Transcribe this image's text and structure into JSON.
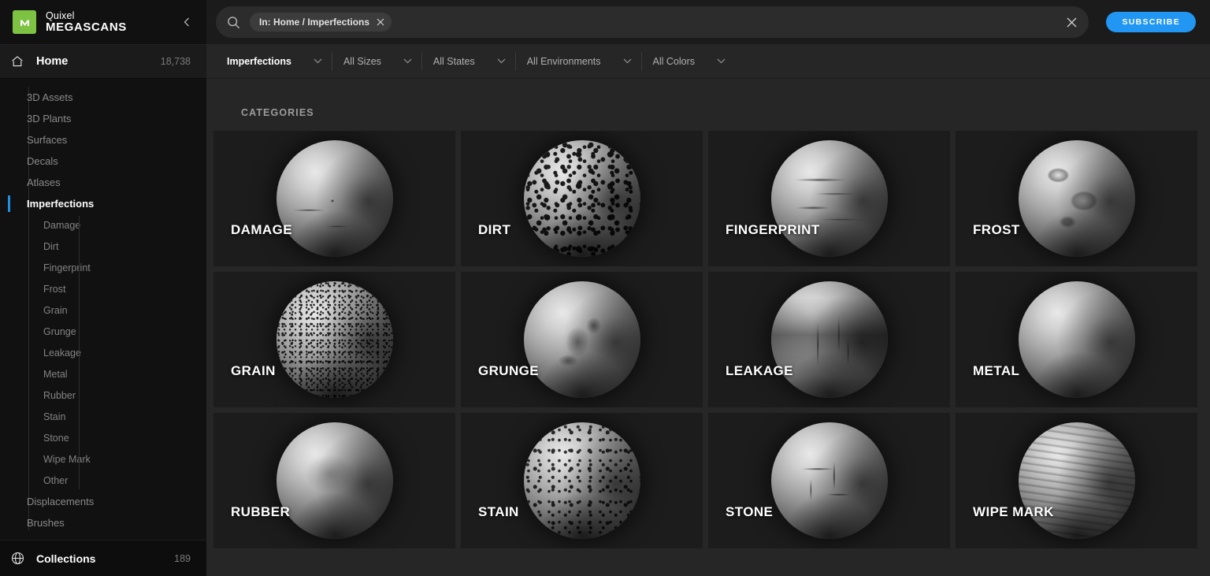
{
  "sidebar": {
    "brand": {
      "top": "Quixel",
      "bottom": "MEGASCANS",
      "collapse_icon": "chevron-left-icon",
      "logo_letter": "m",
      "logo_color": "#7dc242"
    },
    "home": {
      "label": "Home",
      "count": "18,738",
      "icon": "home-icon"
    },
    "items": [
      {
        "label": "3D Assets",
        "active": false
      },
      {
        "label": "3D Plants",
        "active": false
      },
      {
        "label": "Surfaces",
        "active": false
      },
      {
        "label": "Decals",
        "active": false
      },
      {
        "label": "Atlases",
        "active": false
      },
      {
        "label": "Imperfections",
        "active": true
      }
    ],
    "subitems": [
      {
        "label": "Damage"
      },
      {
        "label": "Dirt"
      },
      {
        "label": "Fingerprint"
      },
      {
        "label": "Frost"
      },
      {
        "label": "Grain"
      },
      {
        "label": "Grunge"
      },
      {
        "label": "Leakage"
      },
      {
        "label": "Metal"
      },
      {
        "label": "Rubber"
      },
      {
        "label": "Stain"
      },
      {
        "label": "Stone"
      },
      {
        "label": "Wipe Mark"
      },
      {
        "label": "Other"
      }
    ],
    "items_after": [
      {
        "label": "Displacements",
        "active": false
      },
      {
        "label": "Brushes",
        "active": false
      }
    ],
    "collections": {
      "label": "Collections",
      "count": "189",
      "icon": "globe-icon"
    }
  },
  "topbar": {
    "search_icon": "search-icon",
    "chip": {
      "text": "In: Home / Imperfections",
      "remove_icon": "close-icon"
    },
    "search_value": "",
    "search_placeholder": "",
    "clear_icon": "close-icon",
    "subscribe_label": "SUBSCRIBE",
    "subscribe_color": "#2196f3"
  },
  "filters": [
    {
      "label": "Imperfections",
      "primary": true,
      "chevron": "chevron-down-icon"
    },
    {
      "label": "All Sizes",
      "primary": false,
      "chevron": "chevron-down-icon"
    },
    {
      "label": "All States",
      "primary": false,
      "chevron": "chevron-down-icon"
    },
    {
      "label": "All Environments",
      "primary": false,
      "chevron": "chevron-down-icon"
    },
    {
      "label": "All Colors",
      "primary": false,
      "chevron": "chevron-down-icon"
    }
  ],
  "content": {
    "section_title": "CATEGORIES",
    "cards": [
      {
        "label": "DAMAGE",
        "tex": "tex-damage"
      },
      {
        "label": "DIRT",
        "tex": "tex-dirt"
      },
      {
        "label": "FINGERPRINT",
        "tex": "tex-fingerprint"
      },
      {
        "label": "FROST",
        "tex": "tex-frost"
      },
      {
        "label": "GRAIN",
        "tex": "tex-grain"
      },
      {
        "label": "GRUNGE",
        "tex": "tex-grunge"
      },
      {
        "label": "LEAKAGE",
        "tex": "tex-leakage"
      },
      {
        "label": "METAL",
        "tex": "tex-metal"
      },
      {
        "label": "RUBBER",
        "tex": "tex-rubber"
      },
      {
        "label": "STAIN",
        "tex": "tex-stain"
      },
      {
        "label": "STONE",
        "tex": "tex-stone"
      },
      {
        "label": "WIPE MARK",
        "tex": "tex-wipemark"
      }
    ]
  }
}
